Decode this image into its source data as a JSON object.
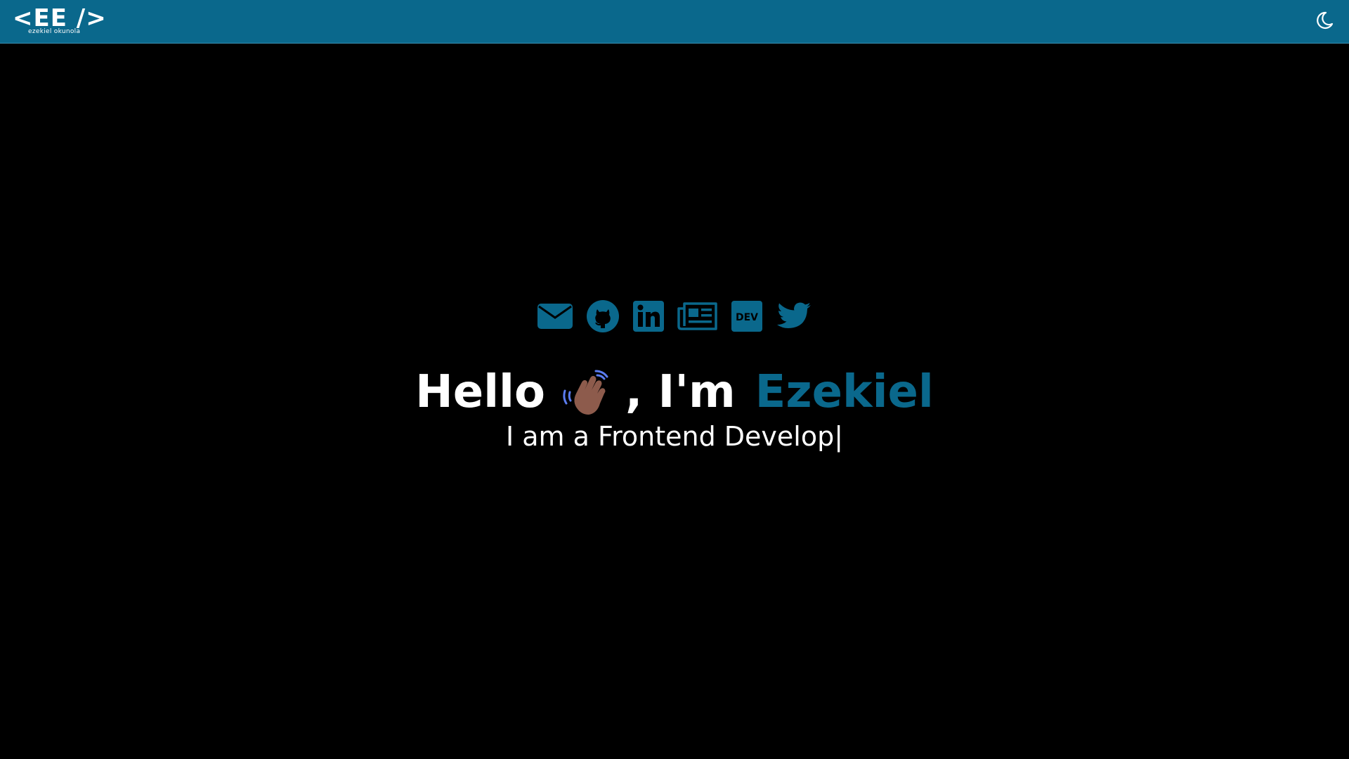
{
  "nav": {
    "logo_main": "<EE />",
    "logo_sub": "ezekiel okunola",
    "theme_icon": "moon-icon"
  },
  "colors": {
    "nav_bg": "#0a688c",
    "accent": "#0a688c",
    "page_bg": "#000000",
    "text": "#ffffff"
  },
  "socials": [
    {
      "icon": "email-icon"
    },
    {
      "icon": "github-icon"
    },
    {
      "icon": "linkedin-icon"
    },
    {
      "icon": "newspaper-icon"
    },
    {
      "icon": "dev-icon",
      "label": "DEV"
    },
    {
      "icon": "twitter-icon"
    }
  ],
  "hero": {
    "greeting": "Hello",
    "wave_icon": "waving-hand-icon",
    "intro": ", I'm",
    "name": "Ezekiel",
    "tagline": "I am a Frontend Develop",
    "cursor": "|"
  }
}
